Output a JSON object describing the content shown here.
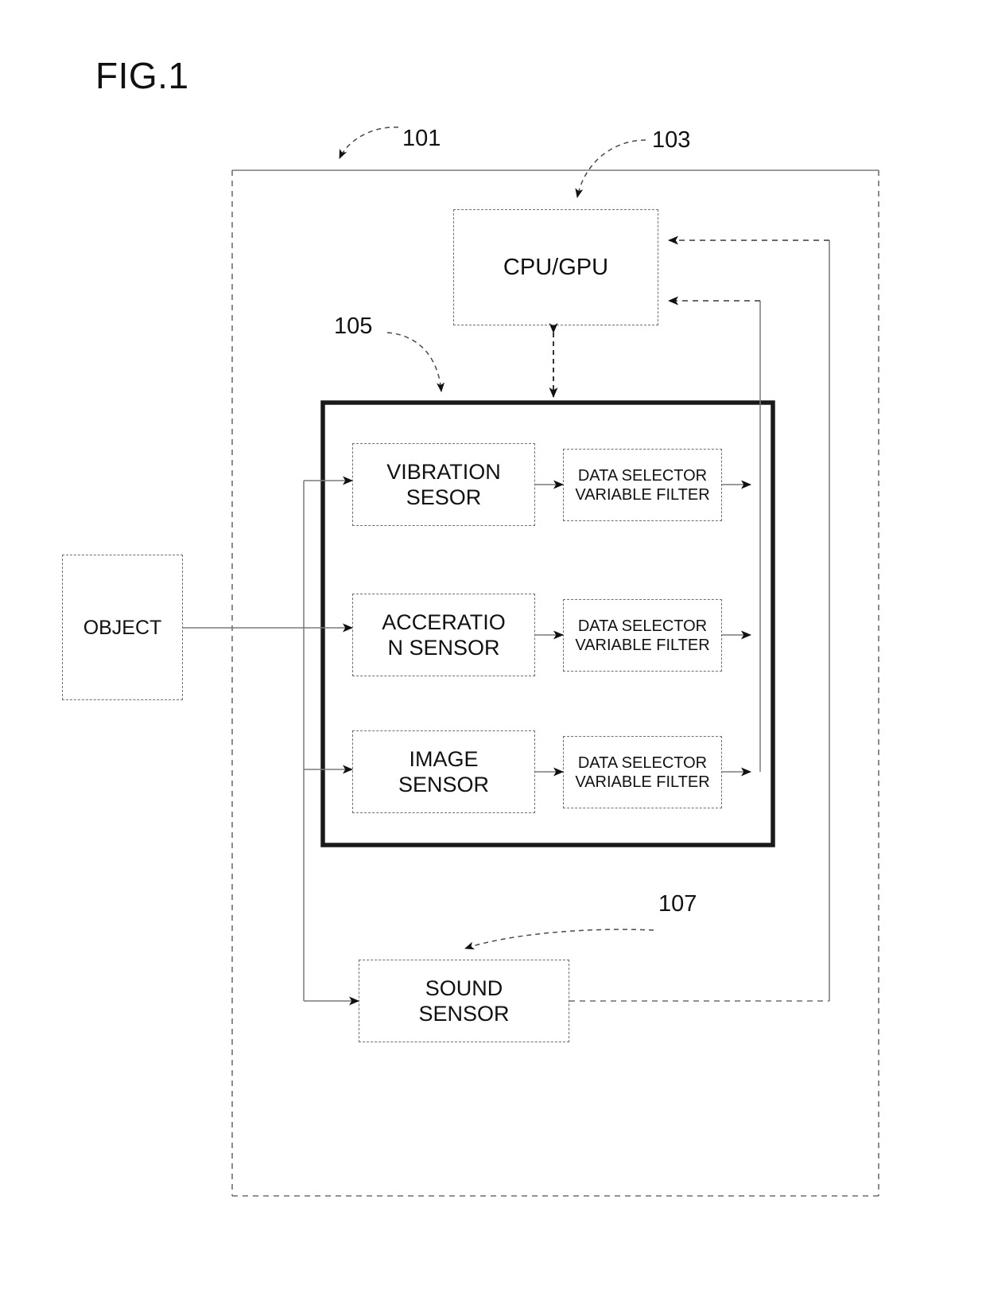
{
  "figure": {
    "title": "FIG.1"
  },
  "reference_numerals": {
    "system": "101",
    "processor": "103",
    "sensor_module": "105",
    "sound_sensor": "107"
  },
  "blocks": {
    "cpu": {
      "label": "CPU/GPU"
    },
    "object": {
      "label": "OBJECT"
    },
    "vibration_sensor": {
      "label": "VIBRATION\nSESOR"
    },
    "acceleration_sensor": {
      "label": "ACCERATIO\nN SENSOR"
    },
    "image_sensor": {
      "label": "IMAGE\nSENSOR"
    },
    "sound_sensor": {
      "label": "SOUND\nSENSOR"
    },
    "filter_1": {
      "label": "DATA SELECTOR\nVARIABLE FILTER"
    },
    "filter_2": {
      "label": "DATA SELECTOR\nVARIABLE FILTER"
    },
    "filter_3": {
      "label": "DATA SELECTOR\nVARIABLE FILTER"
    }
  },
  "colors": {
    "line": "#6f6f6f",
    "solid_line": "#7a7a7a",
    "module_border": "#1a1a1a",
    "text": "#111111",
    "background": "#ffffff"
  }
}
